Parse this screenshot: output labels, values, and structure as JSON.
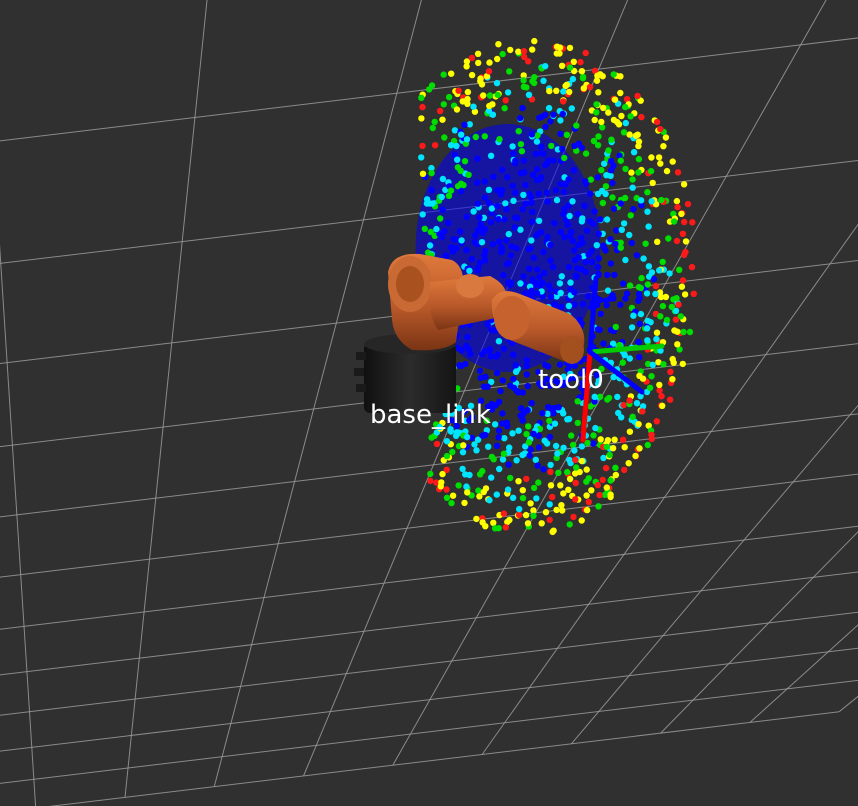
{
  "viewport": {
    "background_color": "#303030",
    "grid_color": "#9a9a9a"
  },
  "frame_labels": {
    "base": "base_link",
    "tool": "tool0"
  },
  "robot": {
    "link_color": "#c8652e",
    "base_color": "#1e1e1e"
  },
  "reachability_map": {
    "colors": [
      "#ff1a1a",
      "#ffff00",
      "#00dd00",
      "#00e5ff",
      "#0000ff"
    ]
  },
  "axes_colors": {
    "x": "#ff0000",
    "y": "#00cc00",
    "z": "#0000ff"
  }
}
